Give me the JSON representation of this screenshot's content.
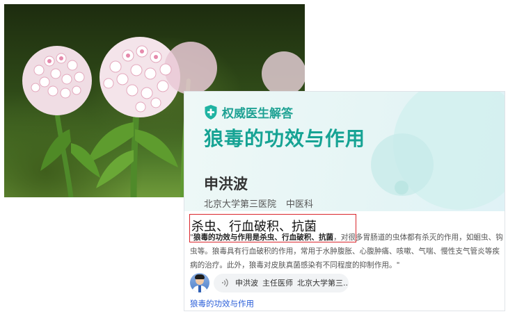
{
  "badge": {
    "label": "权威医生解答"
  },
  "card": {
    "title": "狼毒的功效与作用",
    "doctor_name": "申洪波",
    "hospital": "北京大学第三医院",
    "department": "中医科"
  },
  "answer": {
    "headline": "杀虫、行血破积、抗菌",
    "body_quote_open": "\"",
    "body_bold": "狼毒的功效与作用是杀虫、行血破积、抗菌",
    "body_rest": "，对很多胃肠道的虫体都有杀灭的作用，如蛔虫、钩虫等。狼毒具有行血破积的作用，常用于水肿腹胀、心腹肿痛、咳嗽、气喘、慢性支气管炎等疾病的治疗。此外，狼毒对皮肤真菌感染有不同程度的抑制作用。\""
  },
  "doctor_row": {
    "name": "申洪波",
    "title": "主任医师",
    "hospital_short": "北京大学第三..."
  },
  "related_link": "狼毒的功效与作用",
  "colors": {
    "accent": "#16a394",
    "highlight_border": "#d9252b",
    "link": "#2b5fd9"
  },
  "icons": {
    "badge": "shield-plus-icon",
    "audio": "sound-wave-icon"
  }
}
